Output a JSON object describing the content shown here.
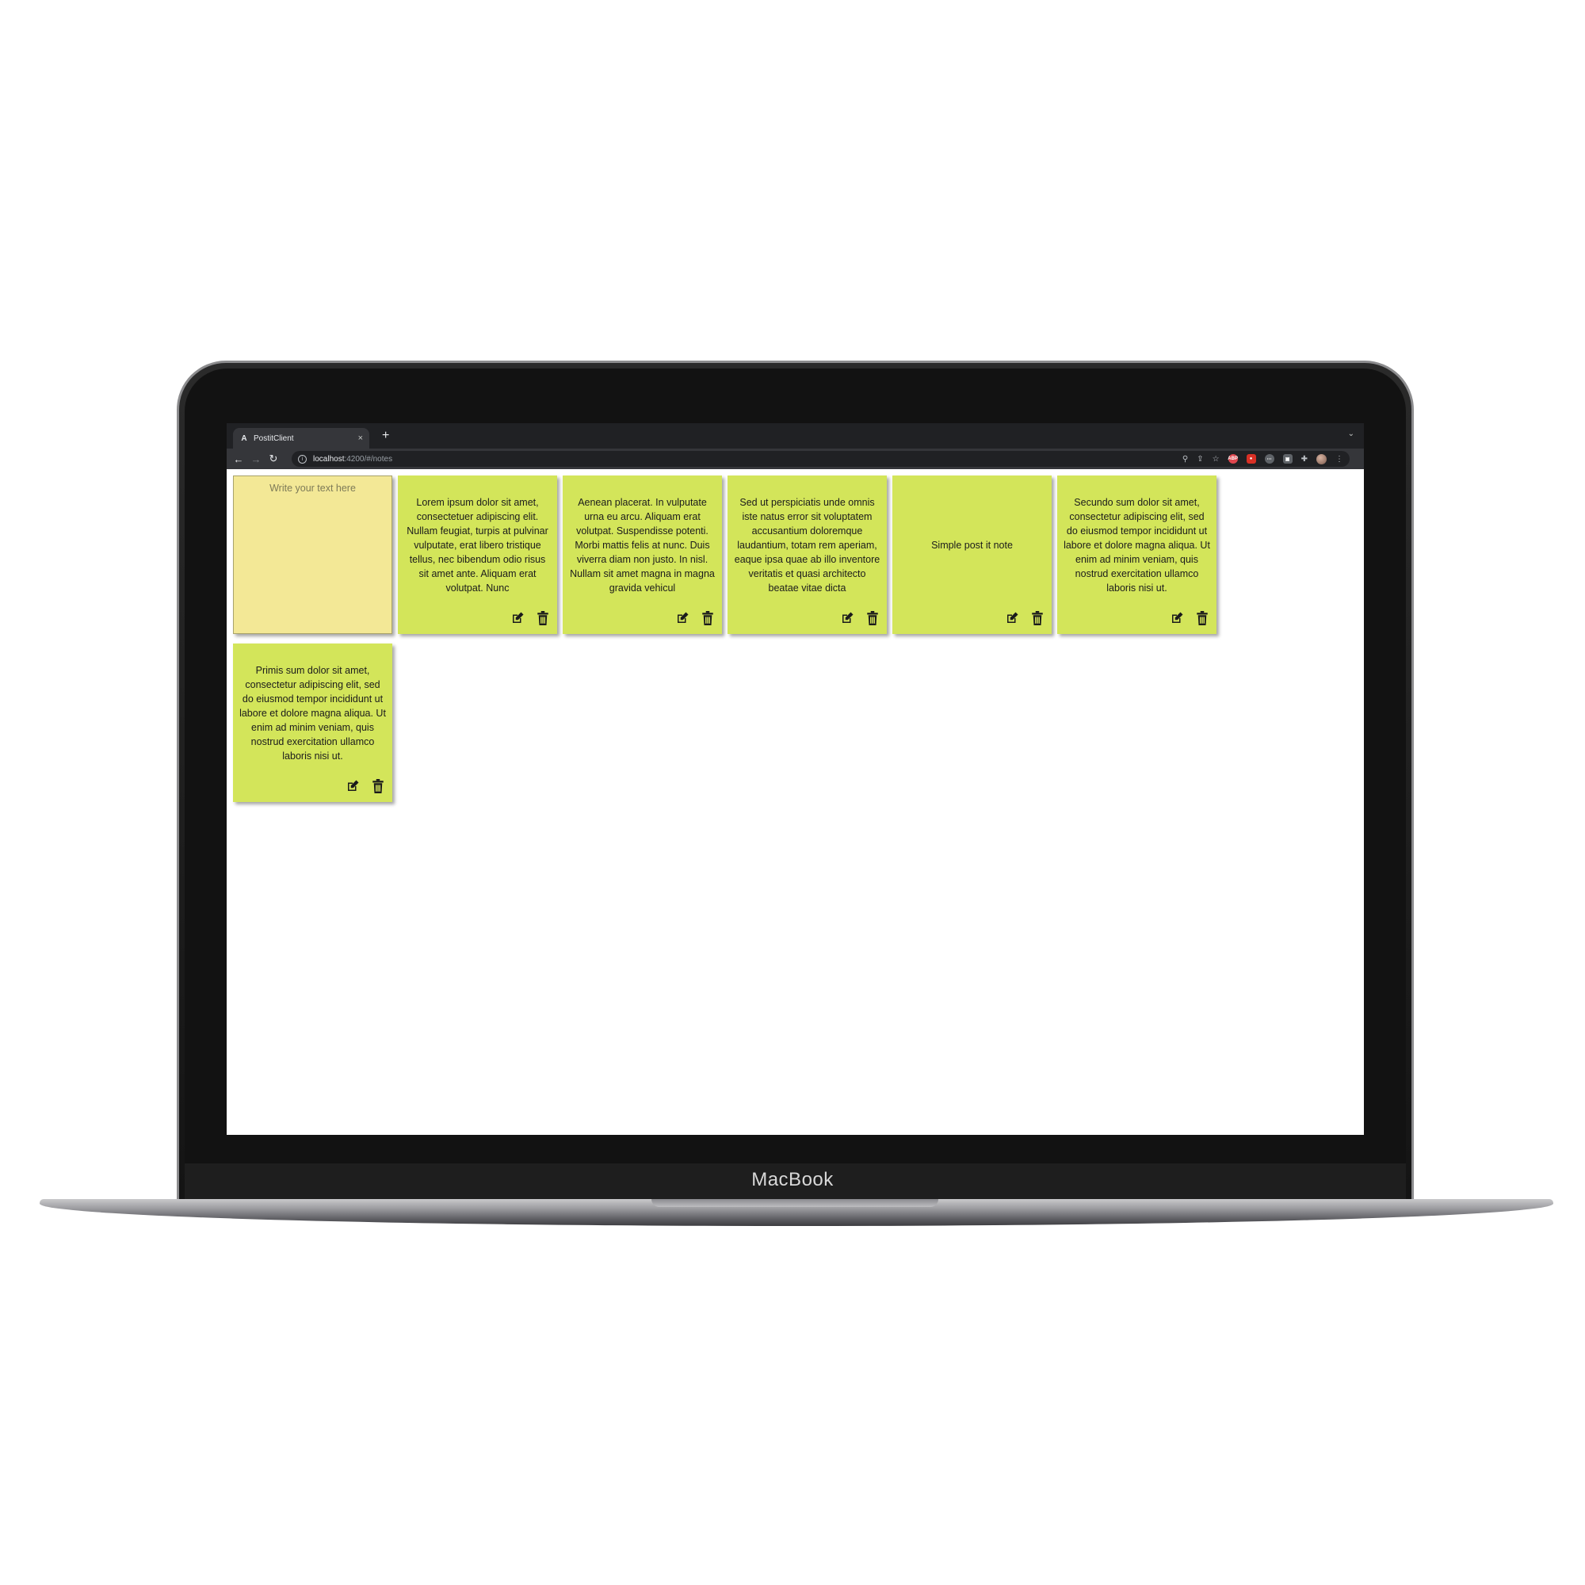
{
  "device": {
    "label": "MacBook"
  },
  "browser": {
    "tab_title": "PostitClient",
    "tab_favicon": "A",
    "tab_close": "×",
    "new_tab": "+",
    "url_host": "localhost",
    "url_path": ":4200/#/notes",
    "extensions": [
      {
        "name": "adblock-icon",
        "text": "ABP",
        "color": "#e0464e"
      },
      {
        "name": "screen-recorder-icon",
        "text": "",
        "color": "#d93025"
      },
      {
        "name": "chat-extension-icon",
        "text": "",
        "color": "#5f6368"
      },
      {
        "name": "id-card-extension-icon",
        "text": "",
        "color": "#5f6368"
      }
    ]
  },
  "composer": {
    "placeholder": "Write your text here"
  },
  "notes": [
    {
      "text": "Lorem ipsum dolor sit amet, consectetuer adipiscing elit. Nullam feugiat, turpis at pulvinar vulputate, erat libero tristique tellus, nec bibendum odio risus sit amet ante. Aliquam erat volutpat. Nunc"
    },
    {
      "text": "Aenean placerat. In vulputate urna eu arcu. Aliquam erat volutpat. Suspendisse potenti. Morbi mattis felis at nunc. Duis viverra diam non justo. In nisl. Nullam sit amet magna in magna gravida vehicul"
    },
    {
      "text": "Sed ut perspiciatis unde omnis iste natus error sit voluptatem accusantium doloremque laudantium, totam rem aperiam, eaque ipsa quae ab illo inventore veritatis et quasi architecto beatae vitae dicta"
    },
    {
      "text": "Simple post it note"
    },
    {
      "text": "Secundo sum dolor sit amet, consectetur adipiscing elit, sed do eiusmod tempor incididunt ut labore et dolore magna aliqua. Ut enim ad minim veniam, quis nostrud exercitation ullamco laboris nisi ut."
    },
    {
      "text": "Primis sum dolor sit amet, consectetur adipiscing elit, sed do eiusmod tempor incididunt ut labore et dolore magna aliqua. Ut enim ad minim veniam, quis nostrud exercitation ullamco laboris nisi ut."
    }
  ],
  "colors": {
    "note": "#d3e55a",
    "composer": "#f3e896"
  }
}
